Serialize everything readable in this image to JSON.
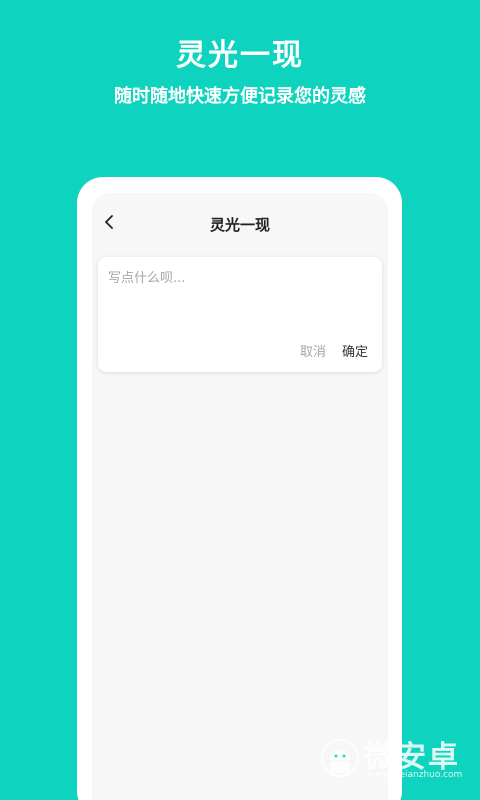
{
  "promo": {
    "title": "灵光一现",
    "subtitle": "随时随地快速方便记录您的灵感"
  },
  "screen": {
    "nav_title": "灵光一现",
    "back_icon": "chevron-left-icon",
    "note_placeholder": "写点什么呗...",
    "note_value": "",
    "cancel_label": "取消",
    "confirm_label": "确定"
  },
  "watermark": {
    "text": "微安卓",
    "url": "www.weianzhuo.com"
  },
  "colors": {
    "background": "#0ED4BF",
    "screen_bg": "#F7F7F7",
    "placeholder": "#A6A6A6",
    "text_dark": "#222222"
  }
}
